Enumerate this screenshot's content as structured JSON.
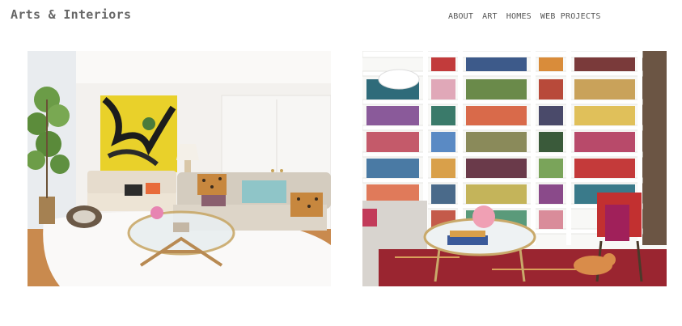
{
  "site": {
    "title": "Arts & Interiors"
  },
  "nav": {
    "items": [
      {
        "label": "ABOUT"
      },
      {
        "label": "ART"
      },
      {
        "label": "HOMES"
      },
      {
        "label": "WEB PROJECTS"
      }
    ]
  },
  "gallery": {
    "images": [
      {
        "subject": "living room with yellow abstract painting, cream sofa and glass coffee table"
      },
      {
        "subject": "white floor-to-ceiling bookshelves with red rug, chair and cat"
      }
    ]
  }
}
